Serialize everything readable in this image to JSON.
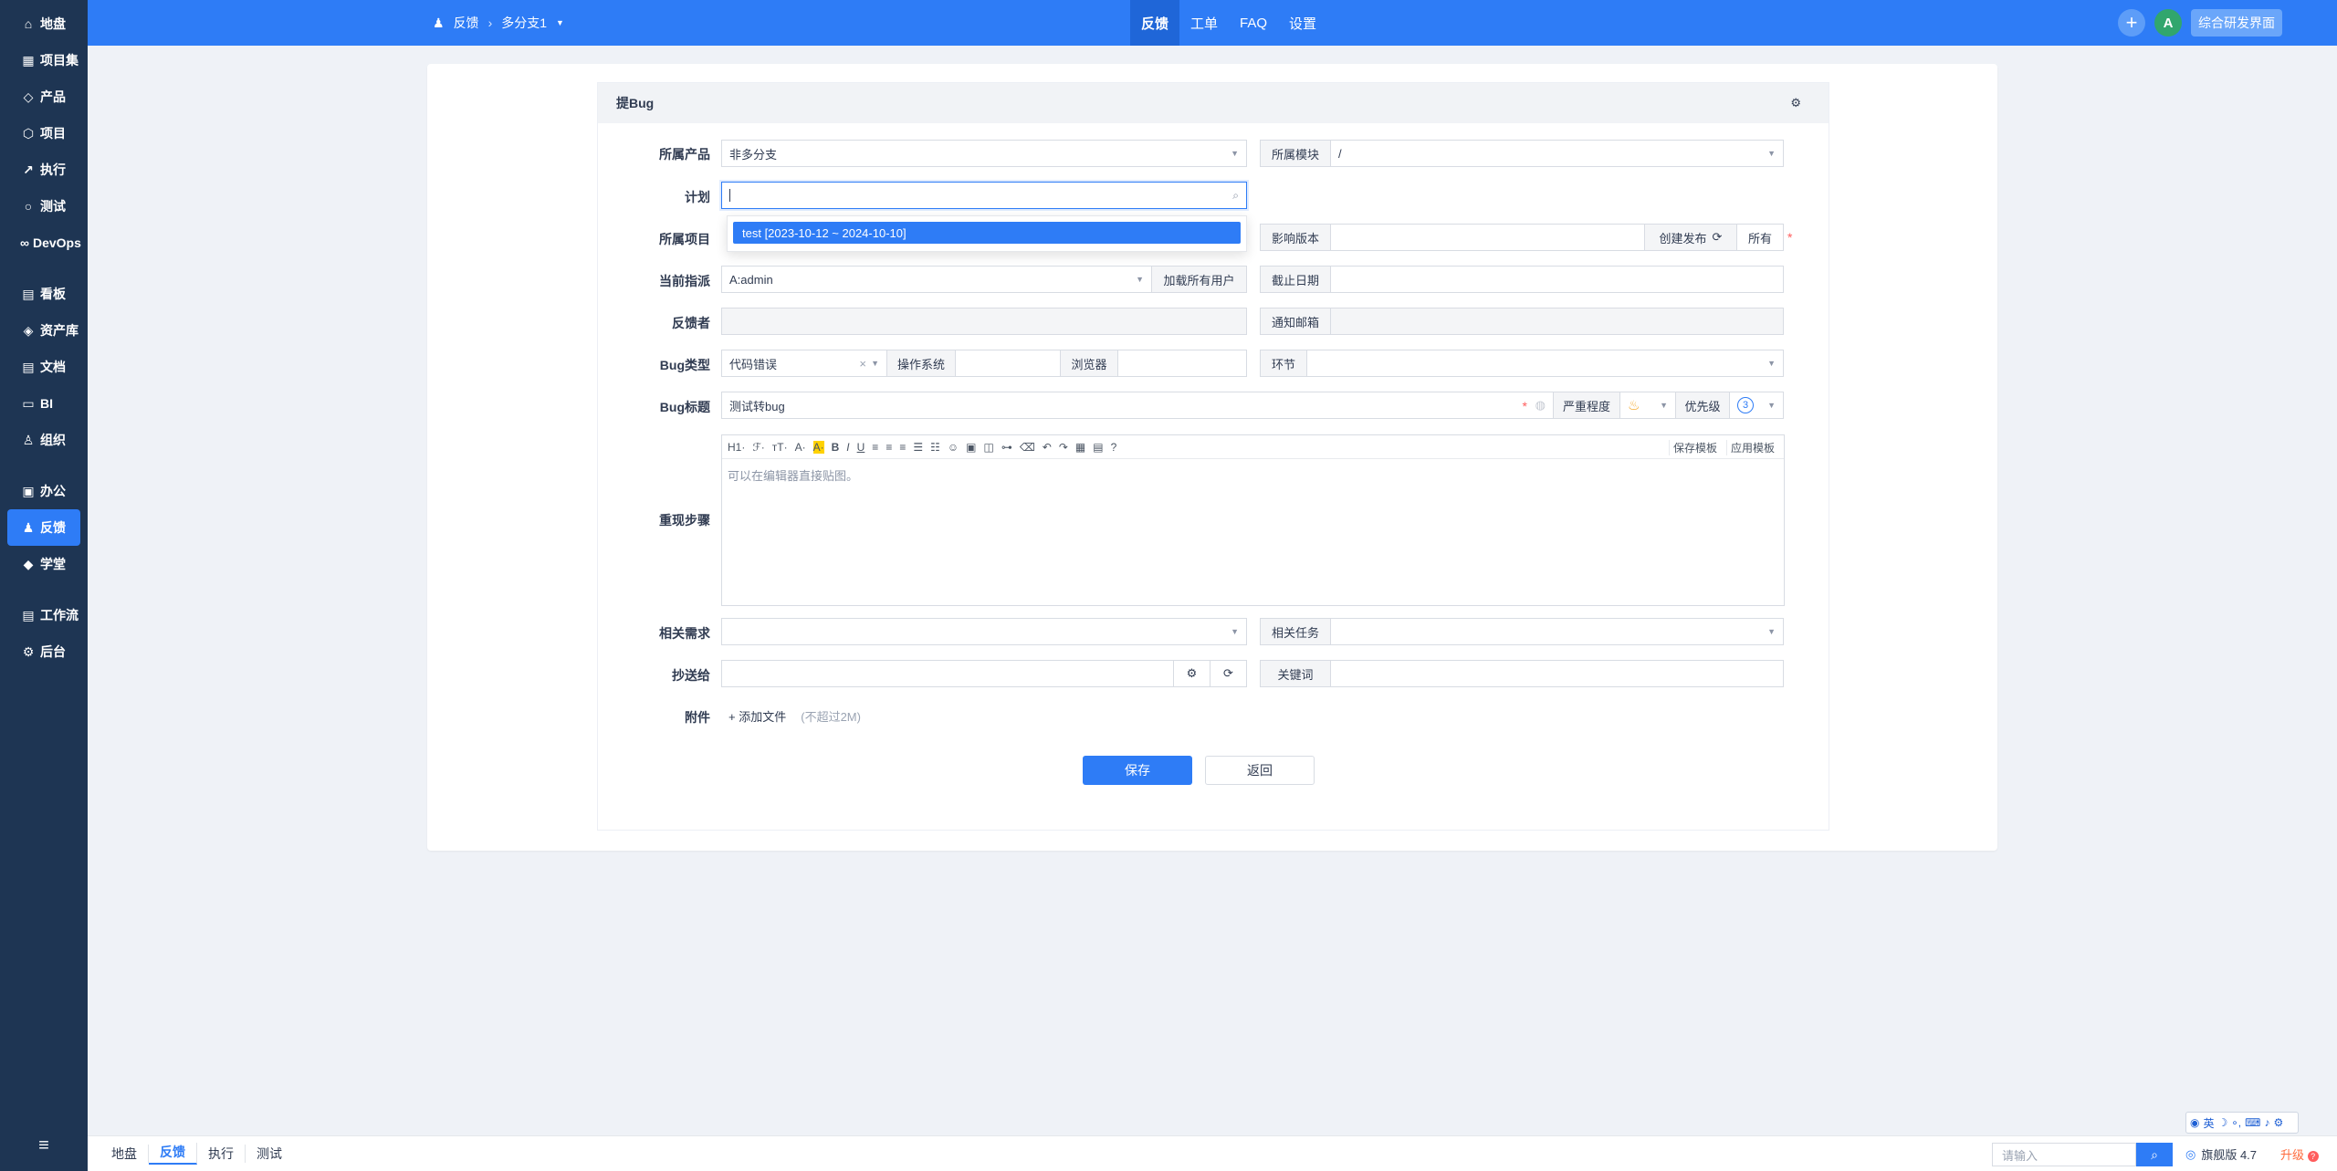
{
  "sidebar": {
    "items": [
      {
        "label": "地盘",
        "icon": "home-icon"
      },
      {
        "label": "项目集",
        "icon": "program-icon"
      },
      {
        "label": "产品",
        "icon": "product-icon"
      },
      {
        "label": "项目",
        "icon": "project-icon"
      },
      {
        "label": "执行",
        "icon": "execution-icon"
      },
      {
        "label": "测试",
        "icon": "test-icon"
      },
      {
        "label": "DevOps",
        "icon": "devops-icon"
      },
      {
        "label": "看板",
        "icon": "kanban-icon"
      },
      {
        "label": "资产库",
        "icon": "asset-icon"
      },
      {
        "label": "文档",
        "icon": "doc-icon"
      },
      {
        "label": "BI",
        "icon": "bi-icon"
      },
      {
        "label": "组织",
        "icon": "org-icon"
      },
      {
        "label": "办公",
        "icon": "office-icon"
      },
      {
        "label": "反馈",
        "icon": "feedback-icon"
      },
      {
        "label": "学堂",
        "icon": "school-icon"
      },
      {
        "label": "工作流",
        "icon": "workflow-icon"
      },
      {
        "label": "后台",
        "icon": "admin-icon"
      }
    ],
    "active_index": 13
  },
  "header": {
    "crumb_root": "反馈",
    "crumb_current": "多分支1",
    "nav": [
      "反馈",
      "工单",
      "FAQ",
      "设置"
    ],
    "avatar_letter": "A",
    "ui_button": "综合研发界面"
  },
  "form": {
    "title": "提Bug",
    "labels": {
      "product": "所属产品",
      "plan": "计划",
      "project": "所属项目",
      "assignee": "当前指派",
      "feedback_by": "反馈者",
      "bug_type": "Bug类型",
      "bug_title": "Bug标题",
      "steps": "重现步骤",
      "story": "相关需求",
      "cc": "抄送给",
      "attach": "附件"
    },
    "product_value": "非多分支",
    "module_label": "所属模块",
    "module_value": "/",
    "plan_value": "",
    "plan_option": "test [2023-10-12 ~ 2024-10-10]",
    "build_label": "影响版本",
    "create_release": "创建发布",
    "all_label": "所有",
    "assignee_value": "A:admin",
    "load_all_users": "加载所有用户",
    "deadline_label": "截止日期",
    "notify_label": "通知邮箱",
    "bug_type_value": "代码错误",
    "os_label": "操作系统",
    "browser_label": "浏览器",
    "stage_label": "环节",
    "bug_title_value": "测试转bug",
    "severity_label": "严重程度",
    "severity_value": "3",
    "priority_label": "优先级",
    "priority_value": "3",
    "editor_placeholder": "可以在编辑器直接贴图。",
    "toolbar": [
      "H1·",
      "ℱ·",
      "тT·",
      "A·",
      "A·",
      "B",
      "I",
      "U"
    ],
    "save_template": "保存模板",
    "apply_template": "应用模板",
    "task_label": "相关任务",
    "keyword_label": "关键词",
    "add_file": "添加文件",
    "file_hint": "(不超过2M)",
    "save": "保存",
    "back": "返回"
  },
  "bottom": {
    "tabs": [
      "地盘",
      "反馈",
      "执行",
      "测试"
    ],
    "active_tab": 1,
    "search_placeholder": "请输入",
    "version": "旗舰版 4.7",
    "upgrade": "升级"
  },
  "ime": {
    "text": "英"
  },
  "colors": {
    "primary": "#2e7cf6",
    "sidebar": "#1e3553",
    "required": "#ff5d5d"
  }
}
